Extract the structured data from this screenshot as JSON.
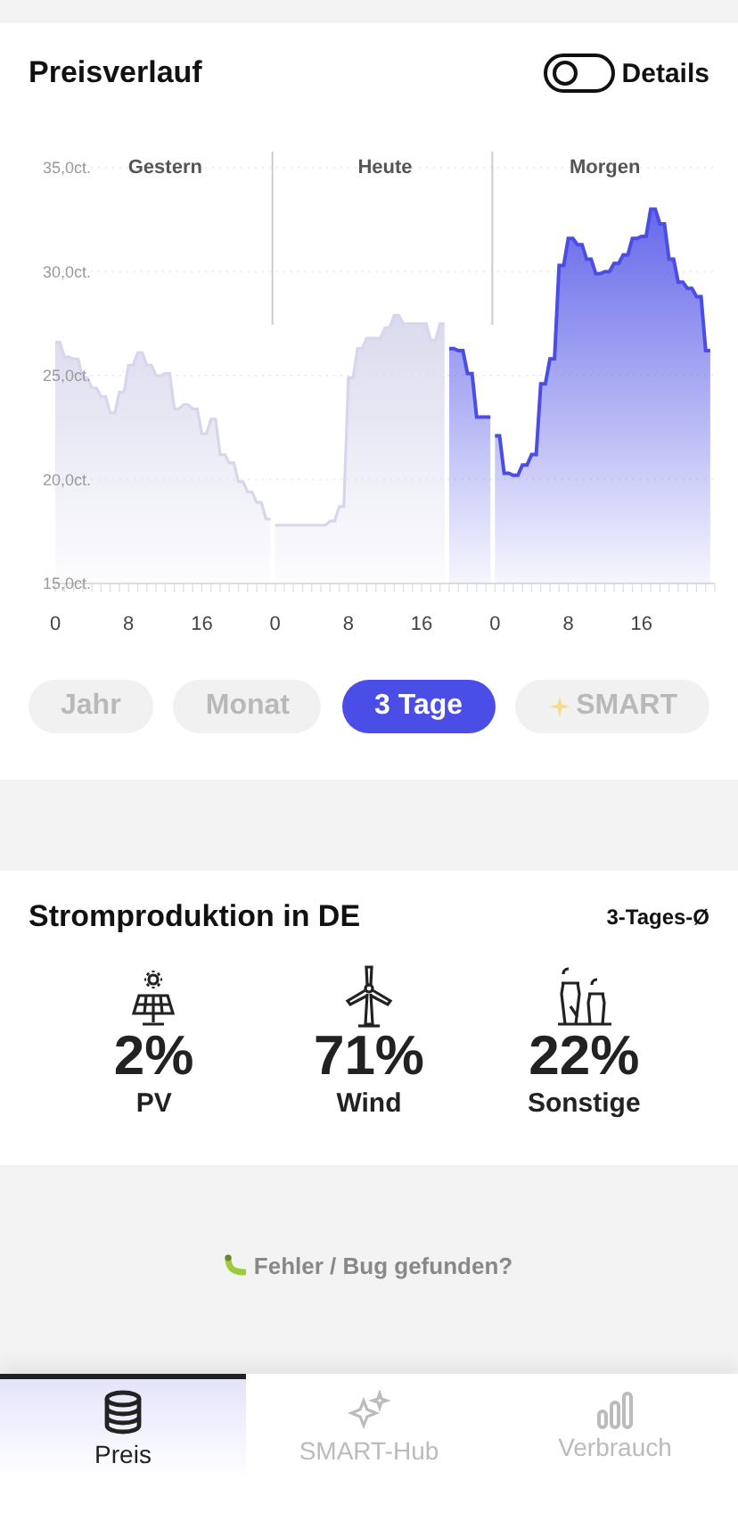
{
  "price_chart": {
    "title": "Preisverlauf",
    "details_toggle": {
      "label": "Details",
      "on": false
    },
    "day_labels": [
      "Gestern",
      "Heute",
      "Morgen"
    ],
    "chart_data": {
      "type": "area",
      "grid": true,
      "categories": [
        "0",
        null,
        null,
        null,
        null,
        null,
        null,
        null,
        null,
        null,
        null,
        null,
        null,
        null,
        null,
        null,
        "8",
        null,
        null,
        null,
        null,
        null,
        null,
        null,
        null,
        null,
        null,
        null,
        null,
        null,
        null,
        null,
        "16",
        null,
        null,
        null,
        null,
        null,
        null,
        null,
        null,
        null,
        null,
        null,
        null,
        null,
        null,
        null,
        "0",
        null,
        null,
        null,
        null,
        null,
        null,
        null,
        null,
        null,
        null,
        null,
        null,
        null,
        null,
        null,
        "8",
        null,
        null,
        null,
        null,
        null,
        null,
        null,
        null,
        null,
        null,
        null,
        null,
        null,
        null,
        null,
        "16",
        null,
        null,
        null,
        null,
        null,
        null,
        null,
        null,
        null,
        null,
        null,
        null,
        null,
        null,
        null,
        "0",
        null,
        null,
        null,
        null,
        null,
        null,
        null,
        null,
        null,
        null,
        null,
        null,
        null,
        null,
        null,
        "8",
        null,
        null,
        null,
        null,
        null,
        null,
        null,
        null,
        null,
        null,
        null,
        null,
        null,
        null,
        null,
        "16",
        null,
        null,
        null,
        null,
        null,
        null,
        null,
        null,
        null,
        null,
        null,
        null,
        null,
        null,
        null
      ],
      "ylim": [
        15,
        35
      ],
      "yticks": [
        {
          "value": 15,
          "label": "15,0ct."
        },
        {
          "value": 20,
          "label": "20,0ct."
        },
        {
          "value": 25,
          "label": "25,0ct."
        },
        {
          "value": 30,
          "label": "30,0ct."
        },
        {
          "value": 35,
          "label": "35,0ct."
        }
      ],
      "series": [
        {
          "color": "#d6d6ec",
          "values": [
            26.6,
            26.6,
            25.9,
            25.9,
            25.8,
            25.8,
            24.9,
            24.9,
            24.4,
            24.4,
            24.0,
            24.0,
            23.2,
            23.2,
            24.2,
            24.2,
            25.5,
            25.5,
            26.1,
            26.1,
            25.5,
            25.5,
            25.0,
            25.0,
            25.1,
            25.1,
            23.4,
            23.4,
            23.6,
            23.6,
            23.4,
            23.4,
            22.2,
            22.2,
            22.9,
            22.9,
            21.2,
            21.2,
            20.8,
            20.8,
            19.9,
            19.9,
            19.4,
            19.4,
            18.9,
            18.9,
            18.1,
            18.1,
            17.8,
            17.8,
            17.8,
            17.8,
            17.8,
            17.8,
            17.8,
            17.8,
            17.8,
            17.8,
            17.8,
            17.8,
            18.0,
            18.0,
            18.7,
            18.7,
            24.9,
            24.9,
            26.3,
            26.3,
            26.8,
            26.8,
            26.8,
            26.8,
            27.3,
            27.3,
            27.9,
            27.9,
            27.5,
            27.5,
            27.5,
            27.5,
            27.5,
            27.5,
            26.7,
            26.7,
            27.5,
            27.5,
            null,
            null,
            null,
            null,
            null,
            null,
            null,
            null,
            null,
            null,
            null,
            null,
            null,
            null,
            null,
            null,
            null,
            null,
            null,
            null,
            null,
            null,
            null,
            null,
            null,
            null,
            null,
            null,
            null,
            null,
            null,
            null,
            null,
            null,
            null,
            null,
            null,
            null,
            null,
            null,
            null,
            null,
            null,
            null,
            null,
            null,
            null,
            null,
            null,
            null,
            null,
            null,
            null,
            null,
            null,
            null,
            null,
            null
          ]
        },
        {
          "color": "#4b4ee6",
          "values": [
            null,
            null,
            null,
            null,
            null,
            null,
            null,
            null,
            null,
            null,
            null,
            null,
            null,
            null,
            null,
            null,
            null,
            null,
            null,
            null,
            null,
            null,
            null,
            null,
            null,
            null,
            null,
            null,
            null,
            null,
            null,
            null,
            null,
            null,
            null,
            null,
            null,
            null,
            null,
            null,
            null,
            null,
            null,
            null,
            null,
            null,
            null,
            null,
            null,
            null,
            null,
            null,
            null,
            null,
            null,
            null,
            null,
            null,
            null,
            null,
            null,
            null,
            null,
            null,
            null,
            null,
            null,
            null,
            null,
            null,
            null,
            null,
            null,
            null,
            null,
            null,
            null,
            null,
            null,
            null,
            null,
            null,
            null,
            null,
            null,
            null,
            26.3,
            26.3,
            26.2,
            26.2,
            25.1,
            25.1,
            23.0,
            23.0,
            23.0,
            23.0,
            22.1,
            22.1,
            20.3,
            20.3,
            20.2,
            20.2,
            20.7,
            20.7,
            21.2,
            21.2,
            24.6,
            24.6,
            25.8,
            25.8,
            30.3,
            30.3,
            31.6,
            31.6,
            31.3,
            31.3,
            30.6,
            30.6,
            29.9,
            29.9,
            30.0,
            30.0,
            30.4,
            30.4,
            30.8,
            30.8,
            31.6,
            31.6,
            31.7,
            31.7,
            33.0,
            33.0,
            32.3,
            32.3,
            30.6,
            30.6,
            29.5,
            29.5,
            29.2,
            29.2,
            28.8,
            28.8,
            26.2,
            26.2
          ]
        }
      ]
    },
    "range_tabs": [
      {
        "kind": "plain",
        "label": "Jahr",
        "selected": false
      },
      {
        "kind": "plain",
        "label": "Monat",
        "selected": false
      },
      {
        "kind": "plain",
        "label": "3 Tage",
        "selected": true
      },
      {
        "kind": "smart",
        "label": "SMART",
        "selected": false
      }
    ]
  },
  "production": {
    "title": "Stromproduktion in DE",
    "period": "3-Tages-Ø",
    "sources": [
      {
        "kind": "pv",
        "value": "2%",
        "label": "PV"
      },
      {
        "kind": "wind",
        "value": "71%",
        "label": "Wind"
      },
      {
        "kind": "other",
        "value": "22%",
        "label": "Sonstige"
      }
    ]
  },
  "bug_report": {
    "label": "Fehler / Bug gefunden?"
  },
  "nav": [
    {
      "kind": "price",
      "label": "Preis",
      "selected": true
    },
    {
      "kind": "hub",
      "label": "SMART-Hub",
      "selected": false
    },
    {
      "kind": "usage",
      "label": "Verbrauch",
      "selected": false
    }
  ]
}
